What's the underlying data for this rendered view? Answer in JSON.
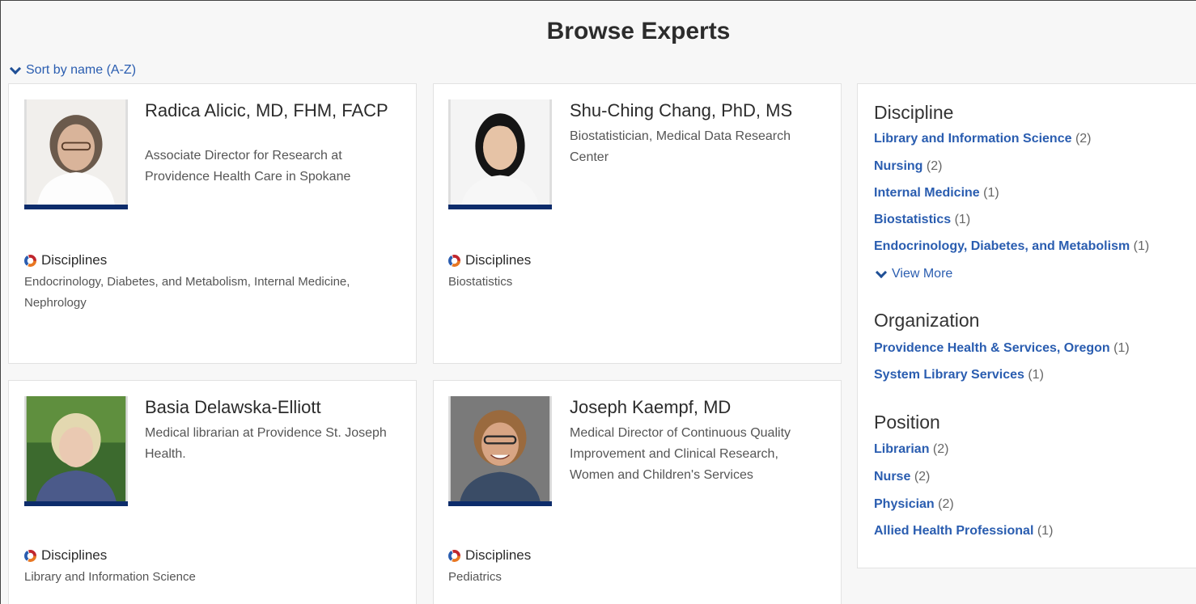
{
  "page_title": "Browse Experts",
  "sort_label": "Sort by name (A-Z)",
  "experts": [
    {
      "name": "Radica Alicic, MD, FHM, FACP",
      "title": "Associate Director for Research at Providence Health Care in Spokane",
      "disciplines_label": "Disciplines",
      "disciplines": "Endocrinology, Diabetes, and Metabolism, Internal Medicine, Nephrology"
    },
    {
      "name": "Shu-Ching Chang, PhD, MS",
      "title": "Biostatistician, Medical Data Research Center",
      "disciplines_label": "Disciplines",
      "disciplines": "Biostatistics"
    },
    {
      "name": "Basia Delawska-Elliott",
      "title": "Medical librarian at Providence St. Joseph Health.",
      "disciplines_label": "Disciplines",
      "disciplines": "Library and Information Science"
    },
    {
      "name": "Joseph Kaempf, MD",
      "title": "Medical Director of Continuous Quality Improvement and Clinical Research, Women and Children's Services",
      "disciplines_label": "Disciplines",
      "disciplines": "Pediatrics"
    }
  ],
  "facets": {
    "discipline": {
      "title": "Discipline",
      "items": [
        {
          "label": "Library and Information Science",
          "count": "(2)"
        },
        {
          "label": "Nursing",
          "count": "(2)"
        },
        {
          "label": "Internal Medicine",
          "count": "(1)"
        },
        {
          "label": "Biostatistics",
          "count": "(1)"
        },
        {
          "label": "Endocrinology, Diabetes, and Metabolism",
          "count": "(1)"
        }
      ],
      "view_more": "View More"
    },
    "organization": {
      "title": "Organization",
      "items": [
        {
          "label": "Providence Health & Services, Oregon",
          "count": "(1)"
        },
        {
          "label": "System Library Services",
          "count": "(1)"
        }
      ]
    },
    "position": {
      "title": "Position",
      "items": [
        {
          "label": "Librarian",
          "count": "(2)"
        },
        {
          "label": "Nurse",
          "count": "(2)"
        },
        {
          "label": "Physician",
          "count": "(2)"
        },
        {
          "label": "Allied Health Professional",
          "count": "(1)"
        }
      ]
    }
  }
}
